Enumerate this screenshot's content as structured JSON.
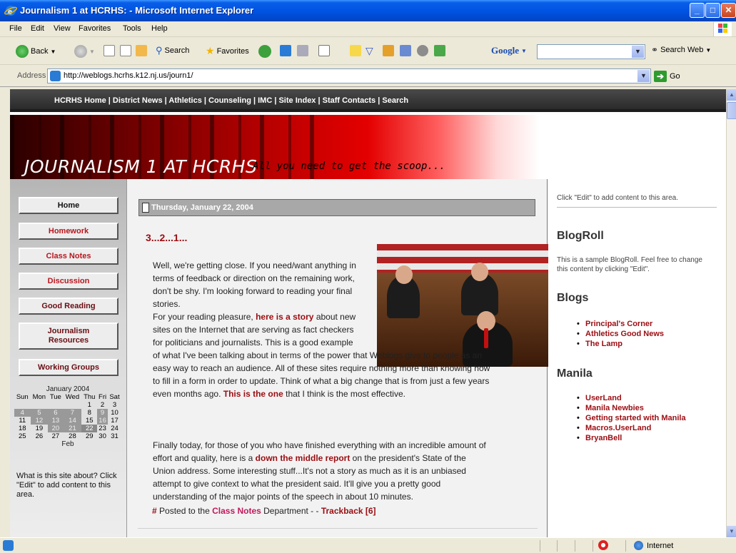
{
  "window": {
    "title": "Journalism 1 at HCRHS: - Microsoft Internet Explorer"
  },
  "menu": [
    "File",
    "Edit",
    "View",
    "Favorites",
    "Tools",
    "Help"
  ],
  "toolbar": {
    "back": "Back",
    "search": "Search",
    "favorites": "Favorites",
    "google": "Google",
    "search_web": "Search Web"
  },
  "address": {
    "label": "Address",
    "url": "http://weblogs.hcrhs.k12.nj.us/journ1/",
    "go": "Go"
  },
  "site": {
    "nav": "HCRHS Home | District News | Athletics | Counseling | IMC | Site Index | Staff Contacts | Search",
    "title": "JOURNALISM 1 AT HCRHS",
    "tagline": "All you need to get the scoop..."
  },
  "sidebar": {
    "items": [
      {
        "label": "Home"
      },
      {
        "label": "Homework"
      },
      {
        "label": "Class Notes"
      },
      {
        "label": "Discussion"
      },
      {
        "label": "Good Reading"
      },
      {
        "label": "Journalism Resources"
      },
      {
        "label": "Working Groups"
      }
    ],
    "about": "What is this site about? Click \"Edit\" to add content to this area."
  },
  "calendar": {
    "caption": "January 2004",
    "days": [
      "Sun",
      "Mon",
      "Tue",
      "Wed",
      "Thu",
      "Fri",
      "Sat"
    ],
    "weeks": [
      [
        "",
        "",
        "",
        "",
        "1",
        "2",
        "3"
      ],
      [
        "4",
        "5",
        "6",
        "7",
        "8",
        "9",
        "10"
      ],
      [
        "11",
        "12",
        "13",
        "14",
        "15",
        "16",
        "17"
      ],
      [
        "18",
        "19",
        "20",
        "21",
        "22",
        "23",
        "24"
      ],
      [
        "25",
        "26",
        "27",
        "28",
        "29",
        "30",
        "31"
      ]
    ],
    "next": "Feb"
  },
  "post": {
    "date": "Thursday, January 22, 2004",
    "title": "3...2...1...",
    "p1": "Well, we're getting close. If you need/want anything in terms of feedback or direction on the remaining work, don't be shy. I'm looking forward to reading your final stories.",
    "p2_lines": [
      "For your reading pleasure,",
      "here is a story",
      "about new",
      "sites on the Internet that are serving as fact checkers",
      "for politicians and journalists. This is a good example",
      "of what I've been talking about in terms of the power that Weblogs give to people as an",
      "easy way to reach an audience. All of these sites require nothing more than knowing how",
      "to fill in a form in order to update. Think of what a big change that is from just a few years",
      "even months ago.",
      "This is the one",
      "that I think is the most effective."
    ],
    "p3_lines": [
      "Finally today, for those of you who have finished everything with an incredible amount of",
      "effort and quality, here is a",
      "down the middle report",
      "on the president's State of the",
      "Union address. Some interesting stuff...It's not a story as much as it is an unbiased",
      "attempt to give context to what the president said. It'll give you a pretty good",
      "understanding of the major points of the speech in about 10 minutes."
    ],
    "footer": {
      "hash": "#",
      "posted": "Posted to the",
      "dept": "Class Notes",
      "dept_suffix": "Department - -",
      "trackback": "Trackback [6]"
    }
  },
  "right": {
    "edit_note": "Click \"Edit\" to add content to this area.",
    "blogroll_heading": "BlogRoll",
    "blogroll_text": "This is a sample BlogRoll. Feel free to change this content by clicking \"Edit\".",
    "blogs_heading": "Blogs",
    "blogs": [
      "Principal's Corner",
      "Athletics Good News",
      "The Lamp"
    ],
    "manila_heading": "Manila",
    "manila": [
      "UserLand",
      "Manila Newbies",
      "Getting started with Manila",
      "Macros.UserLand",
      "BryanBell"
    ]
  },
  "status": {
    "zone": "Internet"
  },
  "colors": {
    "accent_red": "#9A0D12",
    "xp_blue": "#0054E3"
  }
}
